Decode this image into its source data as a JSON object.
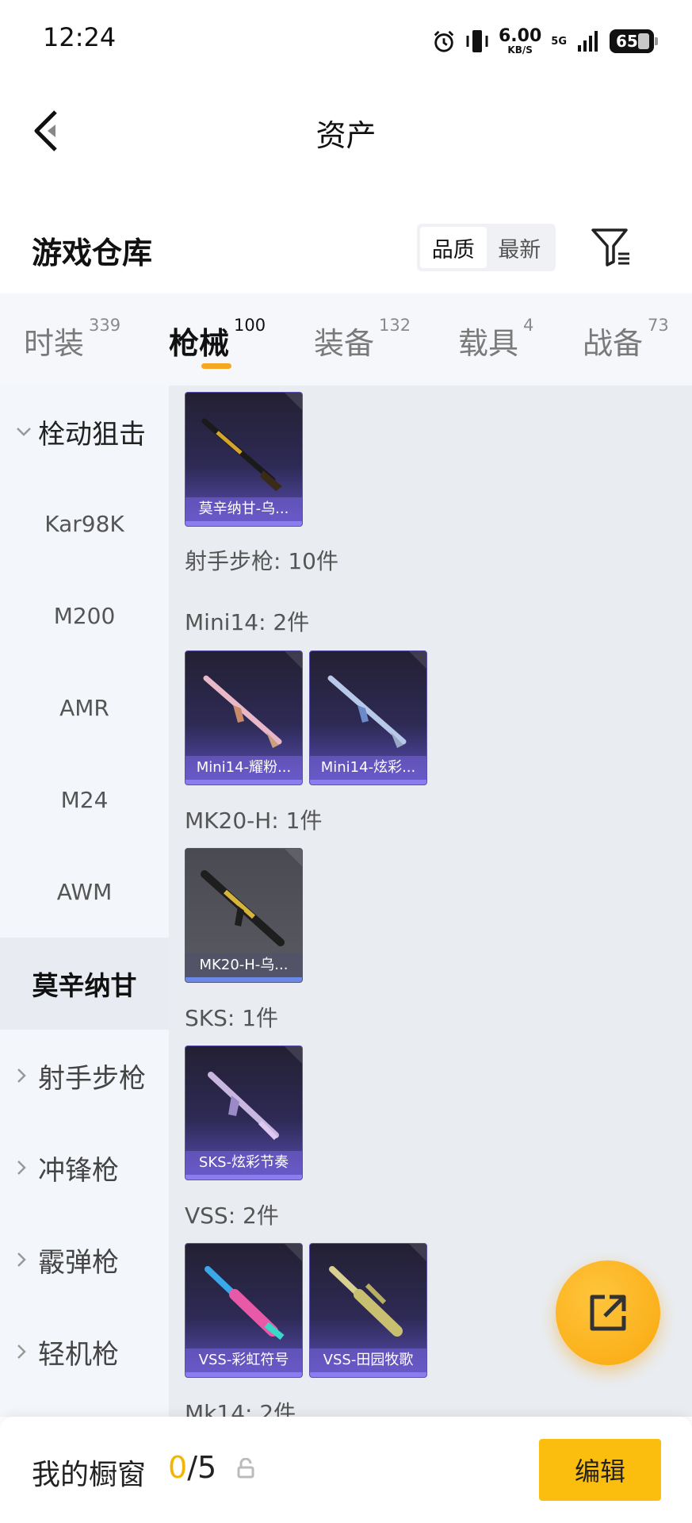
{
  "status_bar": {
    "time": "12:24",
    "net_speed": "6.00",
    "net_unit": "KB/S",
    "network": "5G",
    "battery": "65"
  },
  "header": {
    "title": "资产"
  },
  "section": {
    "title": "游戏仓库",
    "sort_options": [
      "品质",
      "最新"
    ],
    "active_sort": "品质"
  },
  "tabs": [
    {
      "label": "时装",
      "count": "339"
    },
    {
      "label": "枪械",
      "count": "100"
    },
    {
      "label": "装备",
      "count": "132"
    },
    {
      "label": "载具",
      "count": "4"
    },
    {
      "label": "战备",
      "count": "73"
    }
  ],
  "active_tab": "枪械",
  "sidebar": {
    "group_open": "栓动狙击",
    "sub_items": [
      "Kar98K",
      "M200",
      "AMR",
      "M24",
      "AWM",
      "莫辛纳甘"
    ],
    "selected": "莫辛纳甘",
    "groups": [
      "射手步枪",
      "冲锋枪",
      "霰弹枪",
      "轻机枪"
    ]
  },
  "content": {
    "top_card": {
      "name": "莫辛纳甘-乌..."
    },
    "section_header": "射手步枪: 10件",
    "groups": [
      {
        "label": "Mini14: 2件",
        "items": [
          {
            "name": "Mini14-耀粉..."
          },
          {
            "name": "Mini14-炫彩..."
          }
        ]
      },
      {
        "label": "MK20-H: 1件",
        "items": [
          {
            "name": "MK20-H-乌..."
          }
        ]
      },
      {
        "label": "SKS: 1件",
        "items": [
          {
            "name": "SKS-炫彩节奏"
          }
        ]
      },
      {
        "label": "VSS: 2件",
        "items": [
          {
            "name": "VSS-彩虹符号"
          },
          {
            "name": "VSS-田园牧歌"
          }
        ]
      },
      {
        "label": "Mk14: 2件"
      }
    ]
  },
  "bottom_bar": {
    "label": "我的橱窗",
    "current": "0",
    "total": "/5",
    "edit_label": "编辑"
  },
  "colors": {
    "accent": "#fbbd0e",
    "tab_underline": "#f5a623",
    "card_purple": "#2e2a55"
  }
}
